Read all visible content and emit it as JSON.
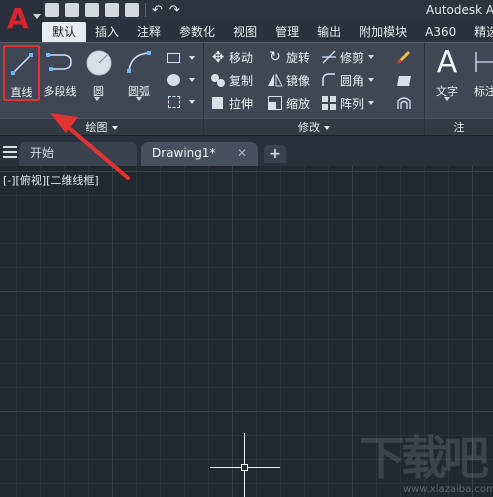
{
  "app": {
    "title": "Autodesk AutoCAD",
    "logo": "A"
  },
  "quick_access": {
    "icons": [
      "new-icon",
      "open-icon",
      "save-icon",
      "save-as-icon",
      "plot-icon",
      "undo-icon",
      "redo-icon"
    ]
  },
  "tabs": [
    {
      "label": "默认",
      "active": true
    },
    {
      "label": "插入"
    },
    {
      "label": "注释"
    },
    {
      "label": "参数化"
    },
    {
      "label": "视图"
    },
    {
      "label": "管理"
    },
    {
      "label": "输出"
    },
    {
      "label": "附加模块"
    },
    {
      "label": "A360"
    },
    {
      "label": "精选"
    }
  ],
  "ribbon": {
    "draw": {
      "title": "绘图",
      "line": "直线",
      "polyline": "多段线",
      "circle": "圆",
      "arc": "圆弧"
    },
    "modify": {
      "title": "修改",
      "move": "移动",
      "rotate": "旋转",
      "trim": "修剪",
      "copy": "复制",
      "mirror": "镜像",
      "fillet": "圆角",
      "stretch": "拉伸",
      "scale": "缩放",
      "array": "阵列"
    },
    "annotation": {
      "title": "注",
      "text": "文字",
      "dimension": "标注"
    }
  },
  "doc_tabs": [
    {
      "label": "开始"
    },
    {
      "label": "Drawing1*",
      "active": true
    }
  ],
  "viewport_label": "[-][俯视][二维线框]",
  "watermark": {
    "text": "下载吧",
    "url": "www.xiazaiba.com"
  },
  "colors": {
    "accent_red": "#e23232",
    "canvas": "#212830",
    "ribbon": "#3f4754",
    "active_tab": "#e7ecf2"
  }
}
